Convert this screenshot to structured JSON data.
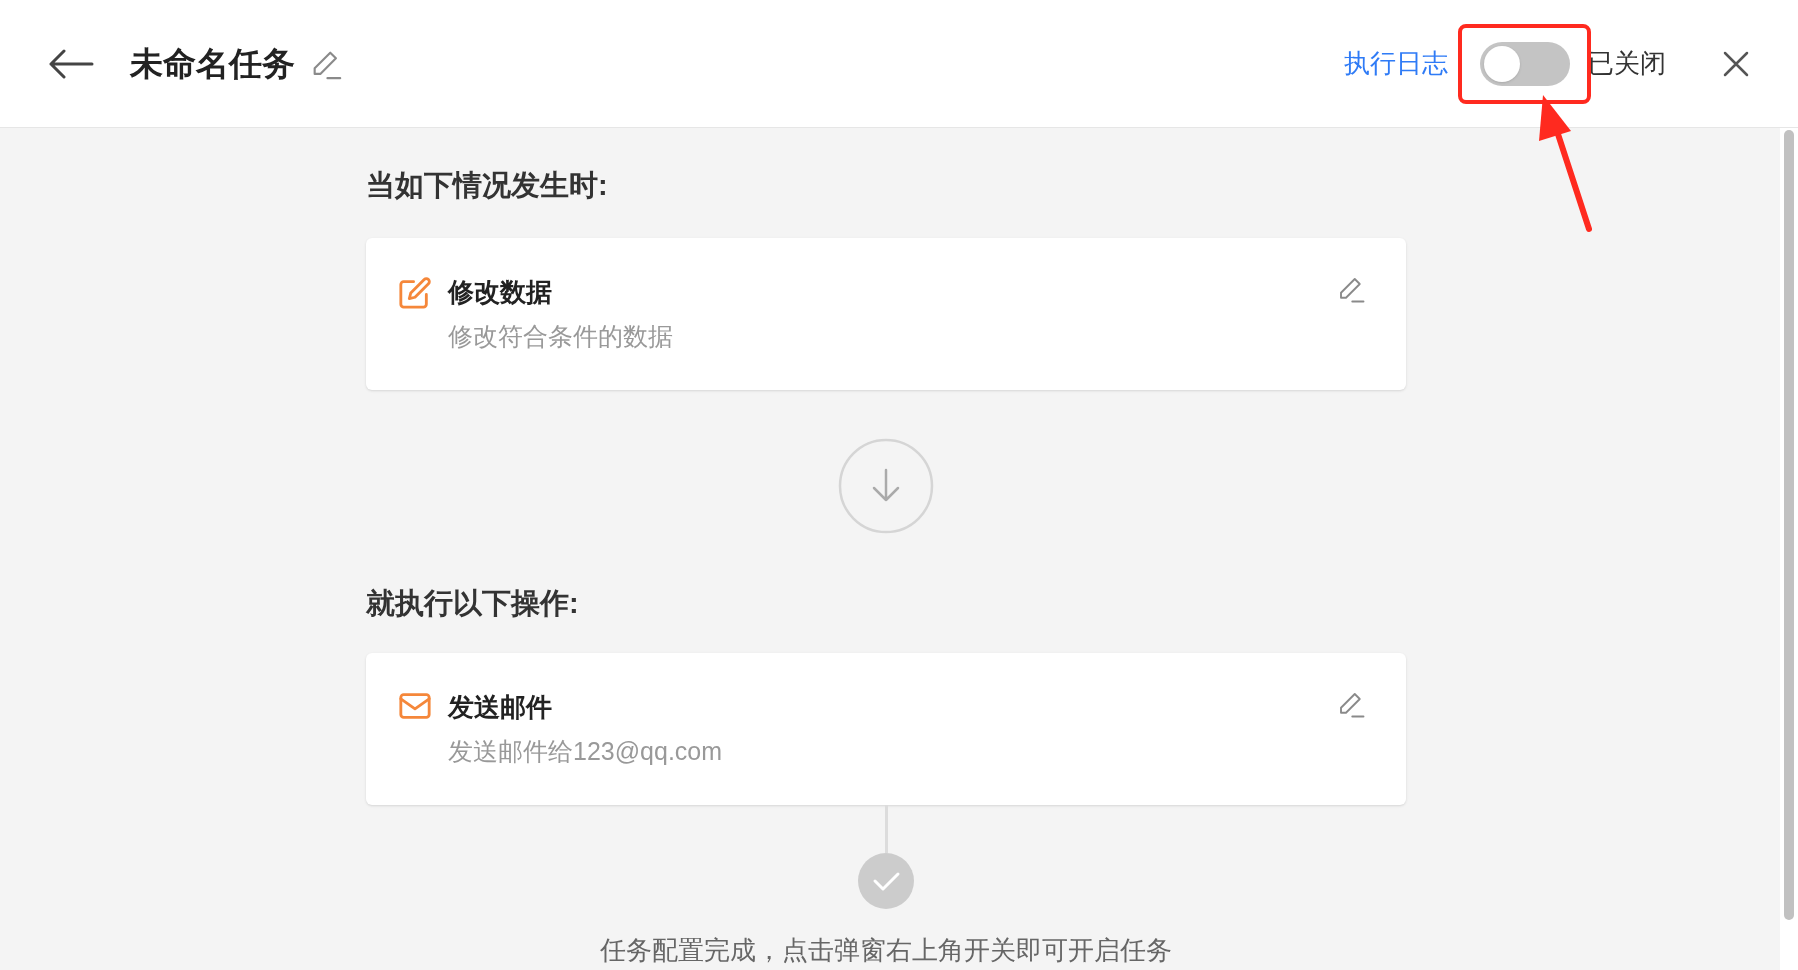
{
  "header": {
    "title": "未命名任务",
    "log_link": "执行日志",
    "toggle": {
      "on": false
    },
    "toggle_label": "已关闭"
  },
  "trigger": {
    "heading": "当如下情况发生时:",
    "card": {
      "kind": "edit",
      "title": "修改数据",
      "description": "修改符合条件的数据"
    }
  },
  "action": {
    "heading": "就执行以下操作:",
    "card": {
      "kind": "mail",
      "title": "发送邮件",
      "description": "发送邮件给123@qq.com"
    }
  },
  "footer": {
    "message": "任务配置完成，点击弹窗右上角开关即可开启任务"
  }
}
